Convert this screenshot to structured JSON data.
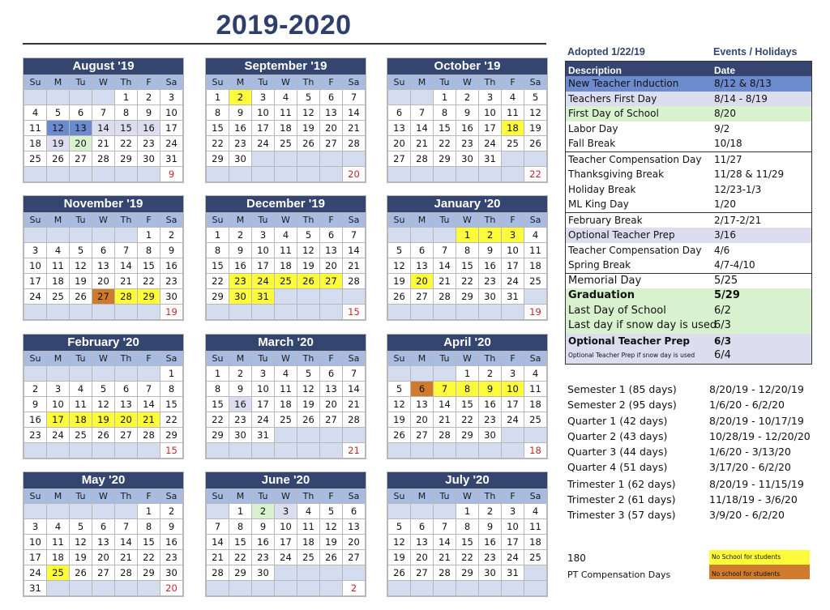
{
  "title": "2019-2020",
  "adopted": "Adopted 1/22/19",
  "events_heading": "Events / Holidays",
  "dow": [
    "Su",
    "M",
    "Tu",
    "W",
    "Th",
    "F",
    "Sa"
  ],
  "colors": {
    "yellow": "#fdfb3a",
    "orange": "#d07a2e",
    "blue": "#6b8bce",
    "lavender": "#ddddf0",
    "green": "#d8f2cf",
    "header": "#34466f"
  },
  "months": [
    {
      "name": "August '19",
      "start": 4,
      "days": 31,
      "count": "9",
      "marks": {
        "12": "blue",
        "13": "blue",
        "14": "lav",
        "15": "lav",
        "16": "lav",
        "19": "lav",
        "20": "green"
      }
    },
    {
      "name": "September '19",
      "start": 0,
      "days": 30,
      "count": "20",
      "marks": {
        "2": "yellow"
      }
    },
    {
      "name": "October '19",
      "start": 2,
      "days": 31,
      "count": "22",
      "marks": {
        "18": "yellow"
      }
    },
    {
      "name": "November '19",
      "start": 5,
      "days": 30,
      "count": "19",
      "marks": {
        "27": "orange",
        "28": "yellow",
        "29": "yellow"
      }
    },
    {
      "name": "December '19",
      "start": 0,
      "days": 31,
      "count": "15",
      "marks": {
        "23": "yellow",
        "24": "yellow",
        "25": "yellow",
        "26": "yellow",
        "27": "yellow",
        "30": "yellow",
        "31": "yellow"
      }
    },
    {
      "name": "January '20",
      "start": 3,
      "days": 31,
      "count": "19",
      "marks": {
        "1": "yellow",
        "2": "yellow",
        "3": "yellow",
        "20": "yellow"
      }
    },
    {
      "name": "February '20",
      "start": 6,
      "days": 29,
      "count": "15",
      "marks": {
        "17": "yellow",
        "18": "yellow",
        "19": "yellow",
        "20": "yellow",
        "21": "yellow"
      }
    },
    {
      "name": "March '20",
      "start": 0,
      "days": 31,
      "count": "21",
      "marks": {
        "16": "lav"
      }
    },
    {
      "name": "April '20",
      "start": 3,
      "days": 30,
      "count": "18",
      "marks": {
        "6": "orange",
        "7": "yellow",
        "8": "yellow",
        "9": "yellow",
        "10": "yellow"
      }
    },
    {
      "name": "May '20",
      "start": 5,
      "days": 31,
      "count": "20",
      "marks": {
        "25": "yellow"
      }
    },
    {
      "name": "June '20",
      "start": 1,
      "days": 30,
      "count": "2",
      "marks": {
        "2": "green",
        "3": "lav"
      }
    },
    {
      "name": "July '20",
      "start": 3,
      "days": 31,
      "count": "",
      "marks": {}
    }
  ],
  "events": {
    "header": {
      "description": "Description",
      "date": "Date"
    },
    "rows": [
      {
        "description": "New Teacher Induction",
        "date": "8/12 & 8/13",
        "bg": "blue"
      },
      {
        "description": "Teachers First Day",
        "date": "8/14 - 8/19",
        "bg": "lav"
      },
      {
        "description": "First Day of School",
        "date": "8/20",
        "bg": "green"
      },
      {
        "description": "Labor Day",
        "date": "9/2",
        "bg": ""
      },
      {
        "description": "Fall Break",
        "date": "10/18",
        "bg": ""
      },
      {
        "description": "Teacher Compensation Day",
        "date": "11/27",
        "bg": "",
        "sep": true
      },
      {
        "description": "Thanksgiving Break",
        "date": "11/28 & 11/29",
        "bg": ""
      },
      {
        "description": "Holiday Break",
        "date": "12/23-1/3",
        "bg": ""
      },
      {
        "description": "ML King Day",
        "date": "1/20",
        "bg": ""
      },
      {
        "description": "February Break",
        "date": "2/17-2/21",
        "bg": "",
        "sep": true
      },
      {
        "description": "Optional Teacher Prep",
        "date": "3/16",
        "bg": "lav"
      },
      {
        "description": "Teacher Compensation Day",
        "date": "4/6",
        "bg": ""
      },
      {
        "description": "Spring Break",
        "date": "4/7-4/10",
        "bg": ""
      },
      {
        "description": "Memorial Day",
        "date": "5/25",
        "bg": "",
        "sep": true,
        "big": true
      },
      {
        "description": "Graduation",
        "date": "5/29",
        "bg": "green",
        "big": true,
        "bold": true
      },
      {
        "description": "Last Day of School",
        "date": "6/2",
        "bg": "green",
        "big": true
      },
      {
        "description": "Last day if snow day is used",
        "date": "6/3",
        "bg": "green",
        "big": true
      },
      {
        "description": "Optional Teacher Prep",
        "date": "6/3",
        "bg": "lav",
        "bold": true
      },
      {
        "description": "Optional Teacher Prep if snow day is used",
        "date": "6/4",
        "bg": "lav",
        "tiny": true,
        "big": true
      }
    ]
  },
  "terms": [
    {
      "name": "Semester 1 (85 days)",
      "dates": "8/20/19 - 12/20/19"
    },
    {
      "name": "Semester 2 (95 days)",
      "dates": "1/6/20 -  6/2/20"
    },
    {
      "name": "Quarter 1 (42 days)",
      "dates": "8/20/19 - 10/17/19"
    },
    {
      "name": "Quarter 2 (43 days)",
      "dates": "10/28/19 - 12/20/20"
    },
    {
      "name": "Quarter 3 (44 days)",
      "dates": "1/6/20 - 3/13/20"
    },
    {
      "name": "Quarter 4 (51 days)",
      "dates": "3/17/20 - 6/2/20"
    },
    {
      "name": "Trimester 1 (62 days)",
      "dates": "8/20/19 - 11/15/19"
    },
    {
      "name": "Trimester 2 (61 days)",
      "dates": "11/18/19 - 3/6/20"
    },
    {
      "name": "Trimester 3 (57 days)",
      "dates": "3/9/20 - 6/2/20"
    }
  ],
  "footer": {
    "total_days": "180",
    "pt_label": "PT Compensation Days",
    "legend_yellow": "No School for students",
    "legend_orange": "No school for students"
  }
}
